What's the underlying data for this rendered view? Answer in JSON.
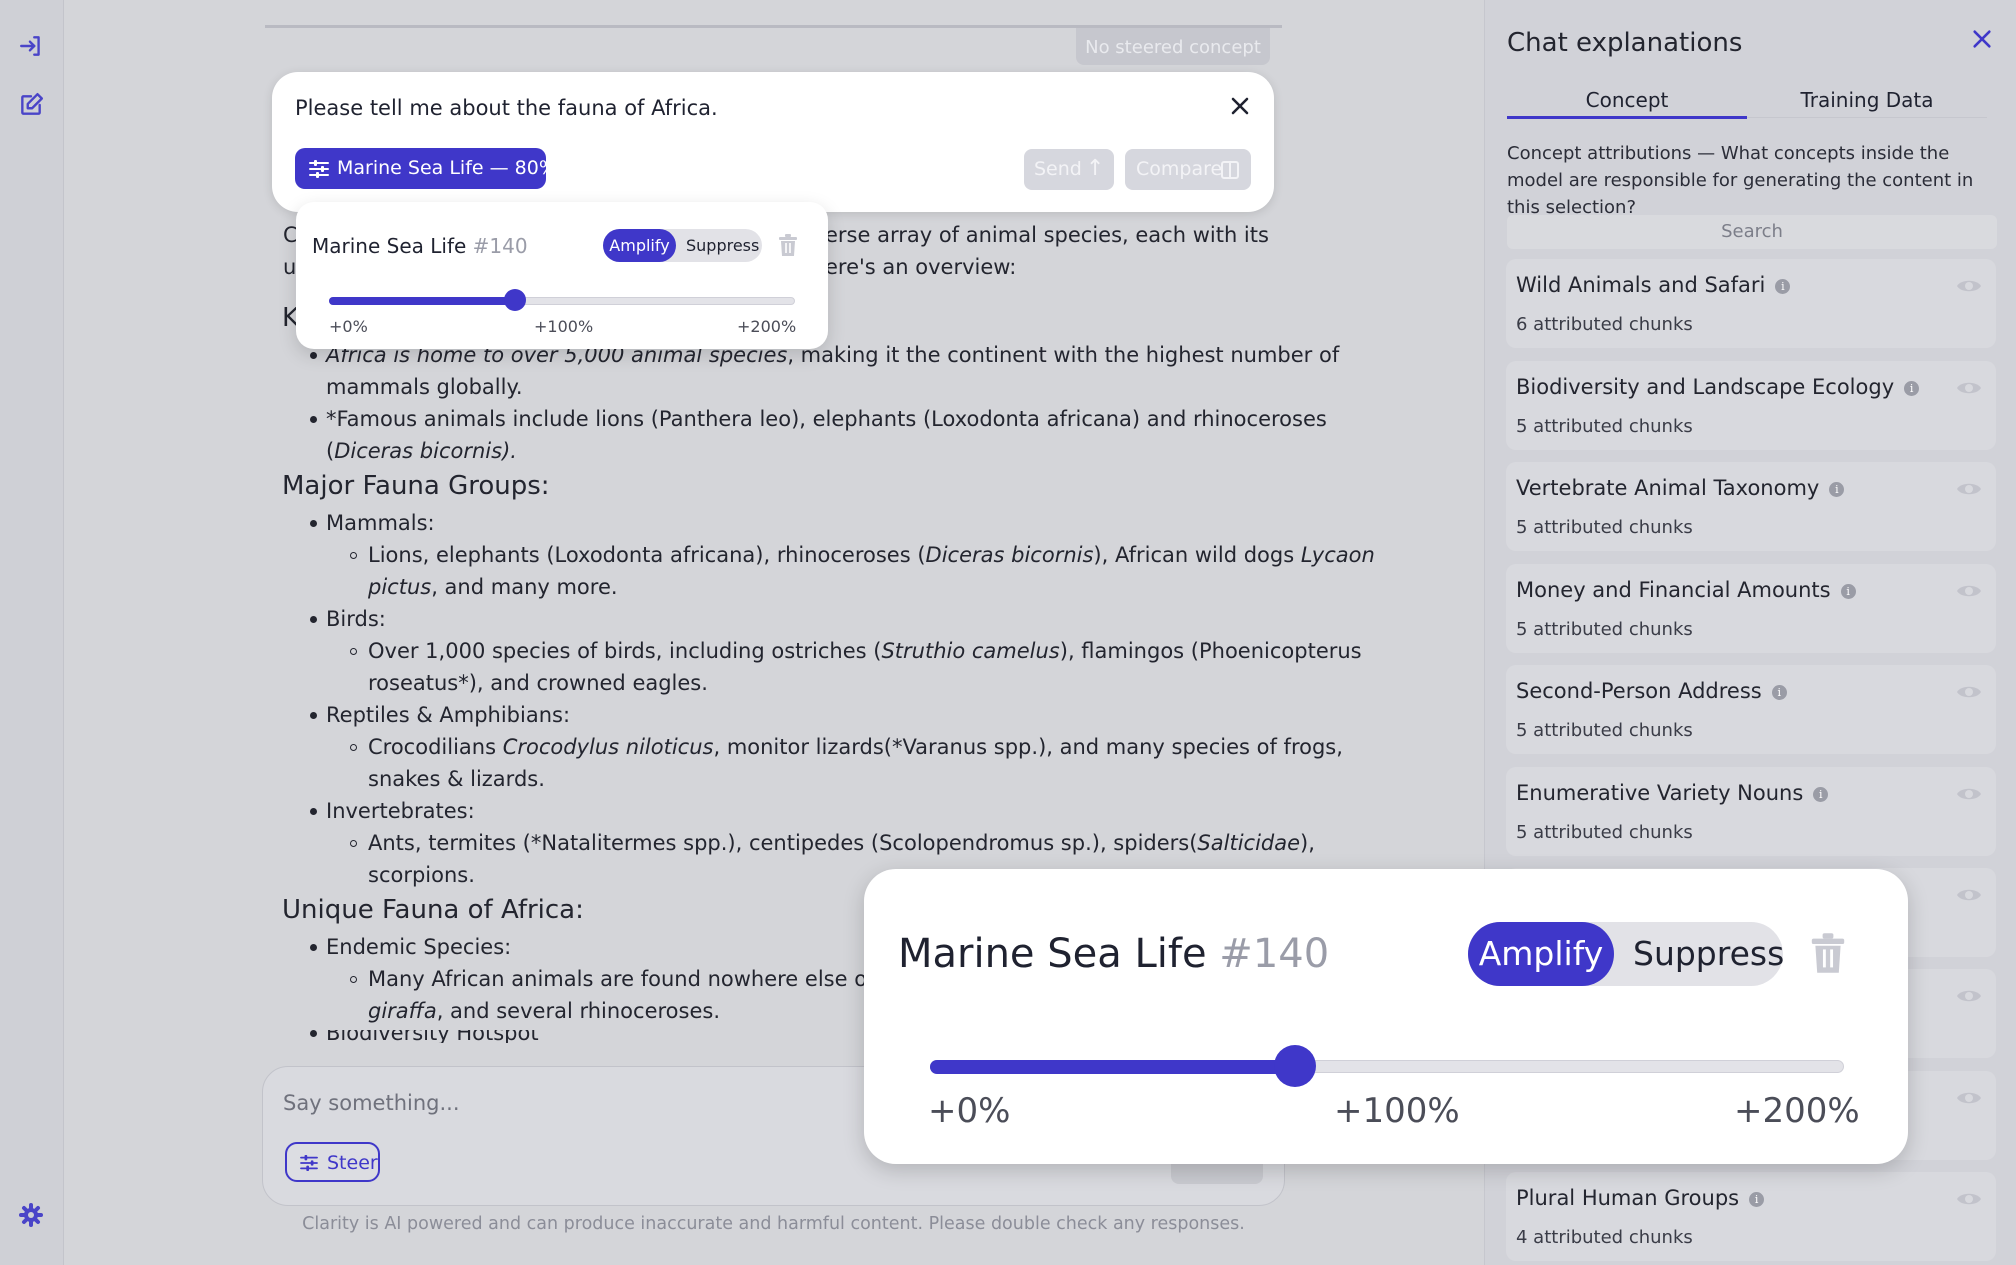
{
  "rail": {
    "icons": [
      "sign-in-icon",
      "edit-icon",
      "settings-icon"
    ]
  },
  "chat": {
    "steer_badge": "No steered concept",
    "prompt_text": "Please tell me about the fauna of Africa.",
    "steer_pill": "Marine Sea Life — 80%",
    "send_label": "Send",
    "compare_label": "Compare",
    "intro_line1_a": "C",
    "intro_line1_b": "erse array of animal species, each with its",
    "intro_line2_a": "u",
    "intro_line2_b": "ere's an overview:",
    "intro_h_a": "K",
    "b1a": "Africa is home to over 5,000 animal species",
    "b1b": ", making it the continent with the highest number of",
    "b1c": "mammals globally.",
    "b2a": "*Famous animals include lions (Panthera leo), elephants (Loxodonta africana) and rhinoceroses",
    "b2b": "(",
    "b2c": "Diceras bicornis).",
    "h_major": "Major Fauna Groups:",
    "mammals": "Mammals:",
    "m1a": "Lions, elephants (Loxodonta africana), rhinoceroses (",
    "m1b": "Diceras bicornis",
    "m1c": "), African wild dogs ",
    "m1d": "Lycaon",
    "m1e": "pictus",
    "m1f": ", and many more.",
    "birds": "Birds:",
    "bd1a": "Over 1,000 species of birds, including ostriches (",
    "bd1b": "Struthio camelus",
    "bd1c": "), flamingos (Phoenicopterus",
    "bd1d": "roseatus*), and crowned eagles.",
    "reptiles": "Reptiles & Amphibians:",
    "r1a": "Crocodilians ",
    "r1b": "Crocodylus niloticus",
    "r1c": ", monitor lizards(*Varanus spp.), and many species of frogs,",
    "r1d": "snakes & lizards.",
    "invert": "Invertebrates:",
    "i1a": "Ants, termites (*Natalitermes spp.), centipedes (Scolopendromus sp.), spiders(",
    "i1b": "Salticidae",
    "i1c": "),",
    "i1d": "scorpions.",
    "h_unique": "Unique Fauna of Africa:",
    "endemic": "Endemic Species:",
    "e1a": "Many African animals are found nowhere else on Ear",
    "e1b": "giraffa",
    "e1c": ", and several rhinoceroses.",
    "cut": "Biodiversity Hotspot:",
    "composer_placeholder": "Say something...",
    "steer_button": "Steer",
    "disclaimer": "Clarity is AI powered and can produce inaccurate and harmful content. Please double check any responses."
  },
  "concept_popover": {
    "name": "Marine Sea Life",
    "id": "#140",
    "amplify": "Amplify",
    "suppress": "Suppress",
    "slider_value_fraction": 0.4,
    "tick_min": "+0%",
    "tick_mid": "+100%",
    "tick_max": "+200%"
  },
  "panel": {
    "title": "Chat explanations",
    "tab_concept": "Concept",
    "tab_training": "Training Data",
    "description": "Concept attributions — What concepts inside the model are responsible for generating the content in this selection?",
    "search_placeholder": "Search",
    "items": [
      {
        "title": "Wild Animals and Safari",
        "sub": "6 attributed chunks"
      },
      {
        "title": "Biodiversity and Landscape Ecology",
        "sub": "5 attributed chunks"
      },
      {
        "title": "Vertebrate Animal Taxonomy",
        "sub": "5 attributed chunks"
      },
      {
        "title": "Money and Financial Amounts",
        "sub": "5 attributed chunks"
      },
      {
        "title": "Second-Person Address",
        "sub": "5 attributed chunks"
      },
      {
        "title": "Enumerative Variety Nouns",
        "sub": "5 attributed chunks"
      },
      {
        "title": "Plural Human Groups",
        "sub": "4 attributed chunks"
      }
    ]
  },
  "colors": {
    "accent": "#3f37c9",
    "background": "#d4d5d9"
  }
}
